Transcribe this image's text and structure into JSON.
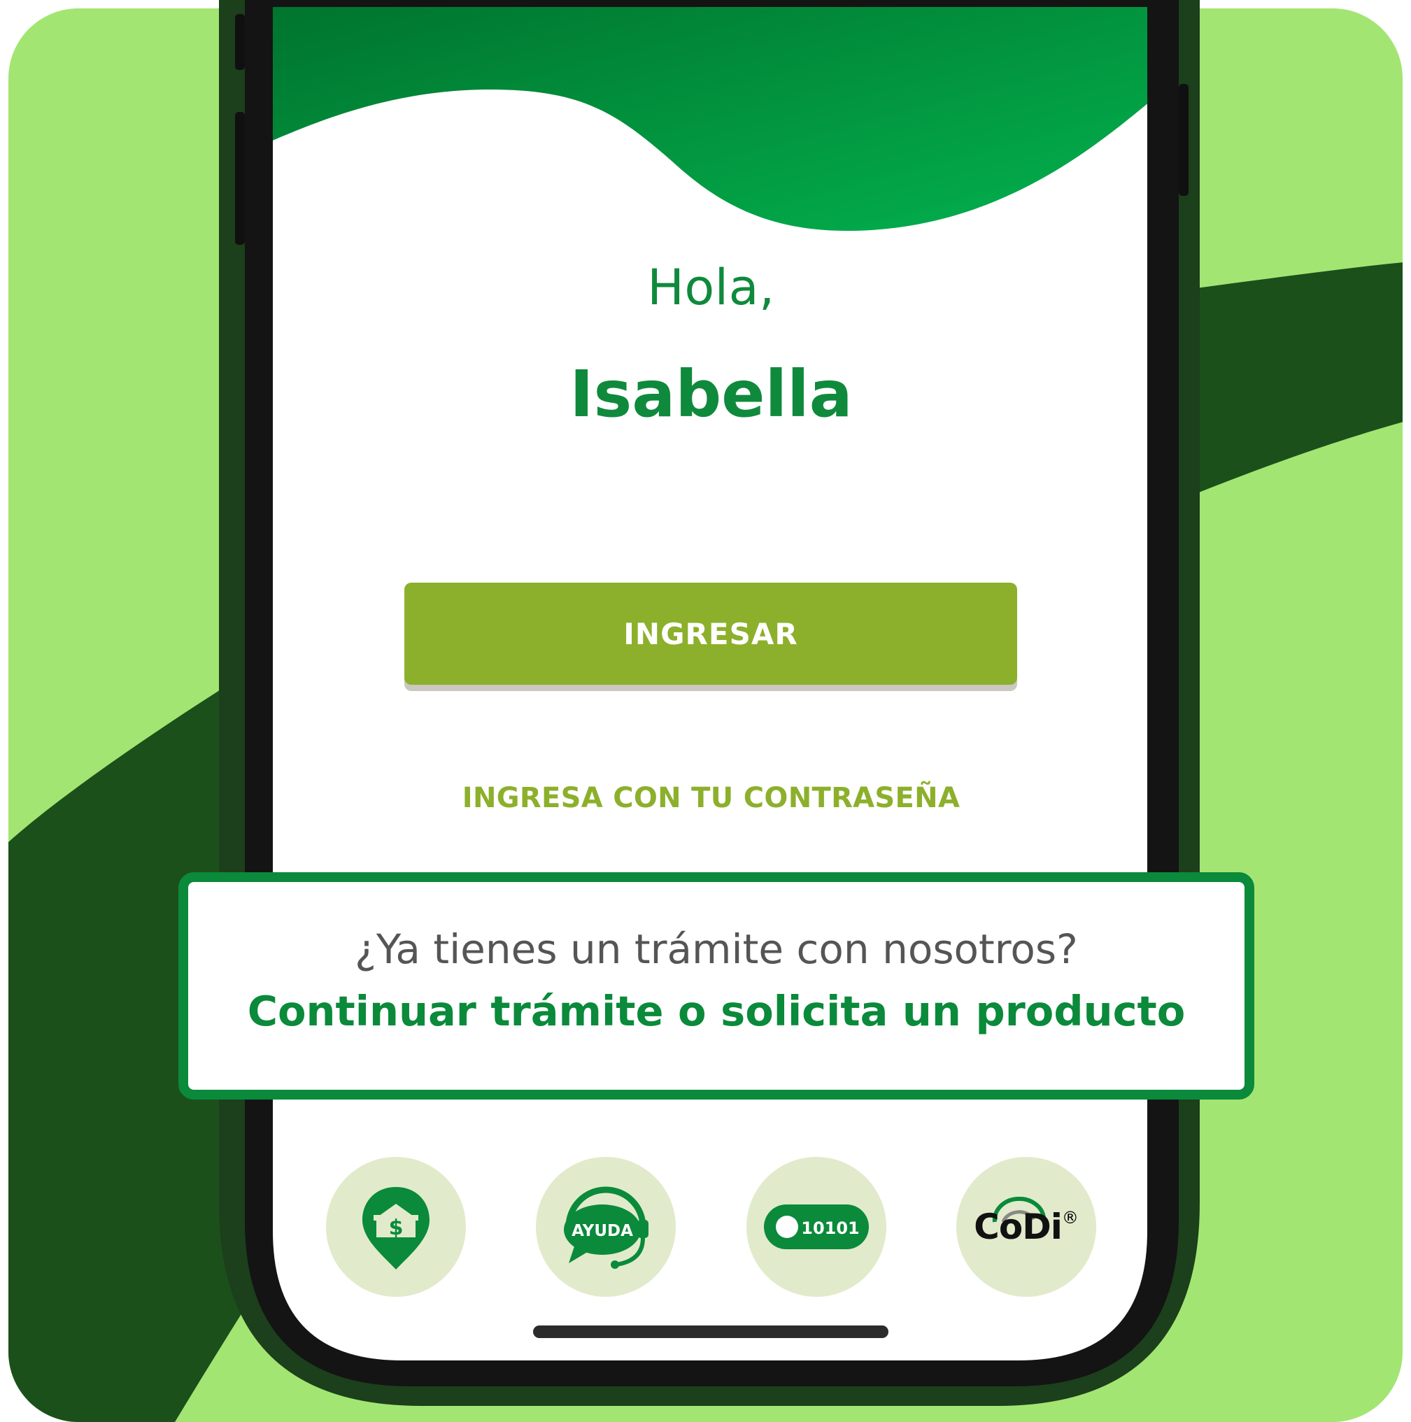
{
  "greeting": {
    "line1": "Hola,",
    "name": "Isabella"
  },
  "actions": {
    "primary_label": "INGRESAR",
    "password_link": "INGRESA CON TU CONTRASEÑA"
  },
  "tramite": {
    "question": "¿Ya tienes un trámite con nosotros?",
    "link": "Continuar trámite o solicita un producto"
  },
  "quick_actions": [
    {
      "icon": "branch-location-icon"
    },
    {
      "icon": "help-headset-icon",
      "label": "AYUDA"
    },
    {
      "icon": "token-toggle-icon",
      "label": "10101"
    },
    {
      "icon": "codi-logo",
      "label": "CoDi"
    }
  ],
  "colors": {
    "outer_background": "#a3e572",
    "dark_band": "#1b501b",
    "header_green": "#03a84a",
    "brand_green": "#0a8a3a",
    "button_olive": "#8cb02b",
    "circle_bg": "#e1ebcb",
    "phone_frame": "#1a1a1a"
  }
}
